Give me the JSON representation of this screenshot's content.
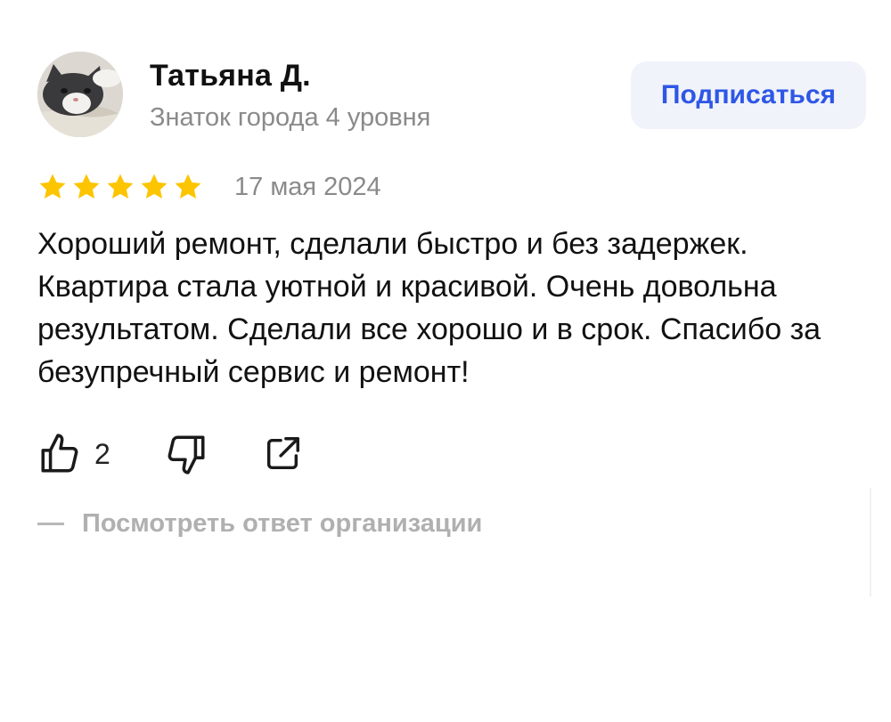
{
  "author": {
    "name": "Татьяна Д.",
    "level": "Знаток города 4 уровня"
  },
  "subscribe": {
    "label": "Подписаться"
  },
  "review": {
    "rating": 5,
    "rating_max": 5,
    "date": "17 мая 2024",
    "text": "Хороший ремонт, сделали быстро и без задержек. Квартира стала уютной и красивой. Очень довольна результатом. Сделали все хорошо и в срок. Спасибо за безупречный сервис и ремонт!"
  },
  "actions": {
    "likes": "2",
    "like_icon": "thumbs-up-icon",
    "dislike_icon": "thumbs-down-icon",
    "share_icon": "share-icon"
  },
  "org_reply": {
    "label": "Посмотреть ответ организации"
  },
  "colors": {
    "star": "#fcc500",
    "accent": "#2e57e6",
    "muted_text": "#8a8a8a",
    "button_bg": "#f0f3fa"
  }
}
